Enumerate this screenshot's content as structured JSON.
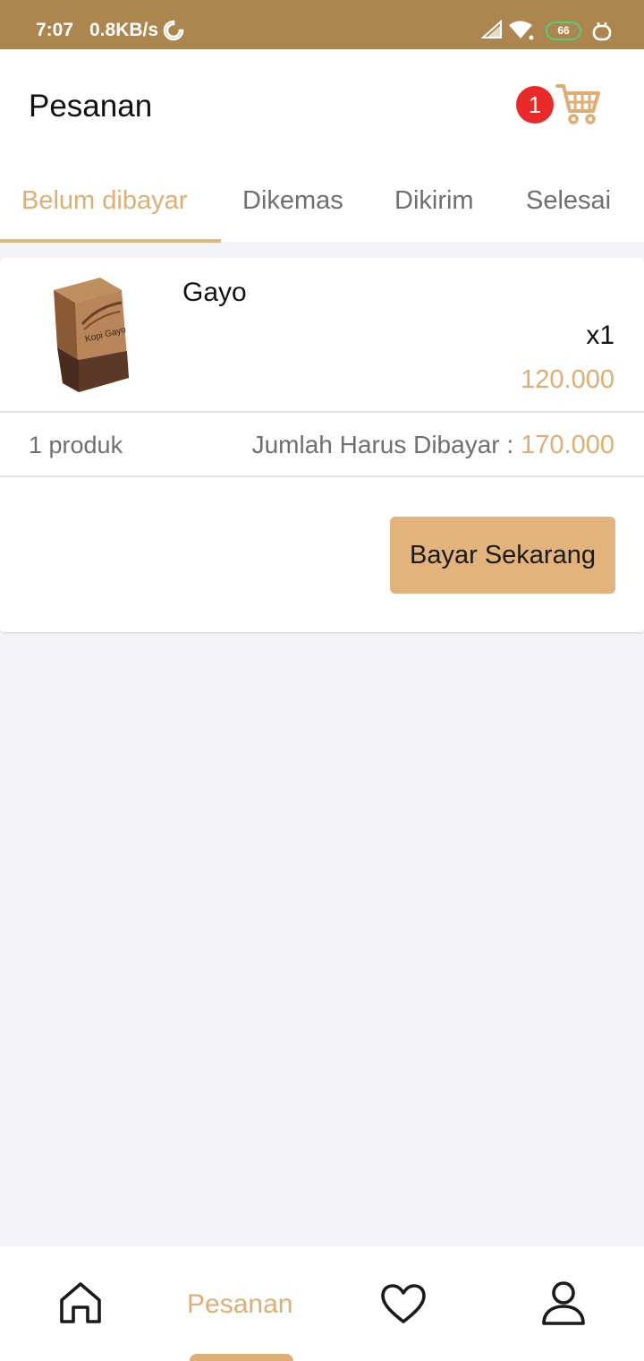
{
  "status_bar": {
    "time": "7:07",
    "speed": "0.8KB/s",
    "battery": "66",
    "icons": [
      "moon-icon",
      "signal-icon",
      "wifi-icon",
      "battery-icon",
      "plug-icon"
    ]
  },
  "header": {
    "title": "Pesanan",
    "cart_count": "1"
  },
  "tabs": [
    {
      "label": "Belum dibayar",
      "active": true
    },
    {
      "label": "Dikemas",
      "active": false
    },
    {
      "label": "Dikirim",
      "active": false
    },
    {
      "label": "Selesai",
      "active": false
    }
  ],
  "order": {
    "product_name": "Gayo",
    "quantity": "x1",
    "price": "120.000",
    "product_count": "1 produk",
    "total_label": "Jumlah Harus Dibayar :",
    "total_value": "170.000",
    "pay_button": "Bayar Sekarang",
    "package_text": "Kopi Gayo"
  },
  "bottom_nav": {
    "active_label": "Pesanan",
    "icons": [
      "home-icon",
      "orders",
      "heart-icon",
      "user-icon"
    ]
  },
  "colors": {
    "accent": "#dfae74",
    "status_bar": "#ad864f",
    "badge": "#ea2a2a",
    "button": "#e2b37b",
    "background": "#f4f4f8"
  }
}
